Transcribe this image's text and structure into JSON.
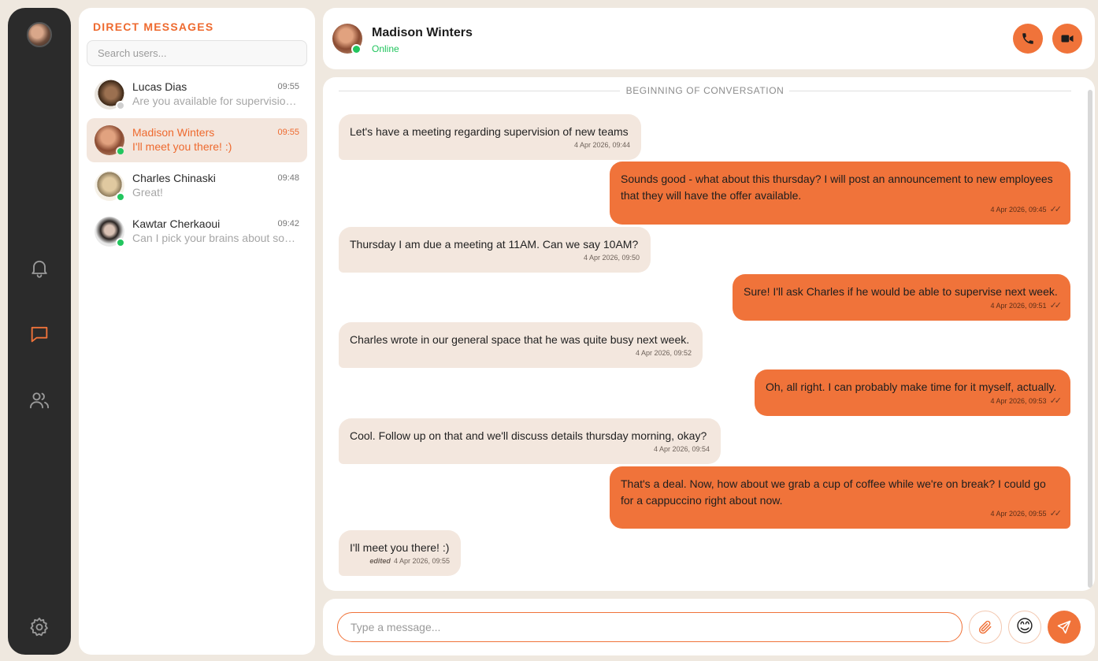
{
  "sidebar": {
    "title": "DIRECT MESSAGES",
    "search_placeholder": "Search users...",
    "contacts": [
      {
        "name": "Lucas Dias",
        "time": "09:55",
        "preview": "Are you available for supervision of new teams?",
        "status": "offline"
      },
      {
        "name": "Madison Winters",
        "time": "09:55",
        "preview": "I'll meet you there! :)",
        "status": "online",
        "active": true
      },
      {
        "name": "Charles Chinaski",
        "time": "09:48",
        "preview": "Great!",
        "status": "online"
      },
      {
        "name": "Kawtar Cherkaoui",
        "time": "09:42",
        "preview": "Can I pick your brains about something?",
        "status": "online"
      }
    ]
  },
  "rail": {
    "icons": [
      "avatar",
      "bell-icon",
      "chat-icon",
      "users-icon",
      "gear-icon"
    ],
    "active": "chat-icon"
  },
  "header": {
    "name": "Madison Winters",
    "status": "Online",
    "call_icon": "phone-icon",
    "video_icon": "video-icon"
  },
  "conversation": {
    "divider": "BEGINNING OF CONVERSATION",
    "messages": [
      {
        "dir": "in",
        "text": "Let's have a meeting regarding supervision of new teams",
        "time": "4 Apr 2026, 09:44"
      },
      {
        "dir": "out",
        "text": "Sounds good - what about this thursday? I will post an announcement to new employees that they will have the offer available.",
        "time": "4 Apr 2026, 09:45",
        "read": "✓✓"
      },
      {
        "dir": "in",
        "text": "Thursday I am due a meeting at 11AM. Can we say 10AM?",
        "time": "4 Apr 2026, 09:50"
      },
      {
        "dir": "out",
        "text": "Sure! I'll ask Charles if he would be able to supervise next week.",
        "time": "4 Apr 2026, 09:51",
        "read": "✓✓"
      },
      {
        "dir": "in",
        "text": "Charles wrote in our general space that he was quite busy next week.",
        "time": "4 Apr 2026, 09:52"
      },
      {
        "dir": "out",
        "text": "Oh, all right. I can probably make time for it myself, actually.",
        "time": "4 Apr 2026, 09:53",
        "read": "✓✓"
      },
      {
        "dir": "in",
        "text": "Cool. Follow up on that and we'll discuss details thursday morning, okay?",
        "time": "4 Apr 2026, 09:54"
      },
      {
        "dir": "out",
        "text": "That's a deal. Now, how about we grab a cup of coffee while we're on break? I could go for a cappuccino right about now.",
        "time": "4 Apr 2026, 09:55",
        "read": "✓✓"
      },
      {
        "dir": "in",
        "text": "I'll meet you there! :)",
        "time": "4 Apr 2026, 09:55",
        "edited": "edited"
      }
    ]
  },
  "composer": {
    "placeholder": "Type a message...",
    "attach_icon": "paperclip-icon",
    "emoji": "😊",
    "send_icon": "send-icon"
  },
  "colors": {
    "accent": "#f0733a",
    "incoming_bubble": "#f3e7de",
    "online": "#22c55e",
    "rail": "#2b2b2b",
    "background": "#efe8df"
  }
}
